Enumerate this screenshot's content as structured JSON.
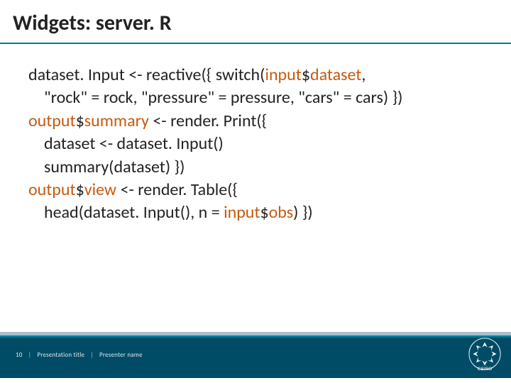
{
  "title": "Widgets: server. R",
  "code": {
    "l1a": "dataset. Input <- reactive({ switch(",
    "l1b": "input",
    "l1c": "$",
    "l1d": "dataset",
    "l1e": ",",
    "l2": "\"rock\" = rock, \"pressure\" = pressure, \"cars\" = cars) })",
    "l3a": "output",
    "l3b": "$",
    "l3c": "summary",
    "l3d": " <- render. Print({",
    "l4": "dataset <- dataset. Input()",
    "l5": "summary(dataset) })",
    "l6a": "output",
    "l6b": "$",
    "l6c": "view",
    "l6d": " <- render. Table({",
    "l7a": "head(dataset. Input(), n = ",
    "l7b": "input",
    "l7c": "$",
    "l7d": "obs",
    "l7e": ") })"
  },
  "footer": {
    "page": "10",
    "presentation_title": "Presentation title",
    "presenter": "Presenter name"
  },
  "logo_text": "CSIRO"
}
